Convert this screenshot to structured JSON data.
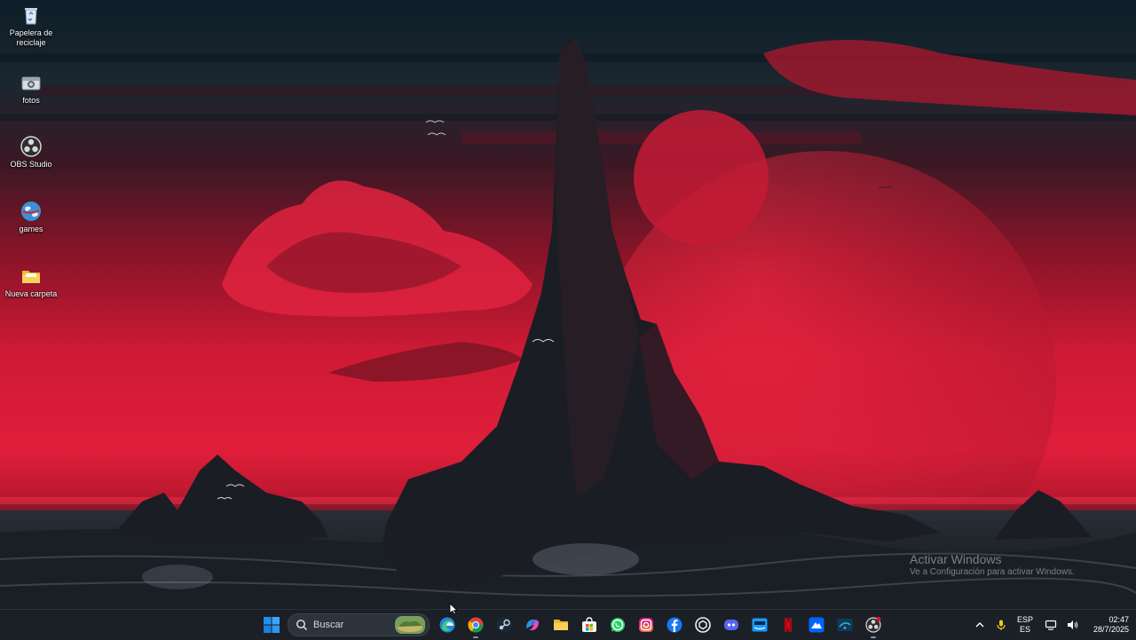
{
  "desktop": {
    "icons": [
      {
        "label": "Papelera de reciclaje",
        "icon": "recycle-bin-icon"
      },
      {
        "label": "fotos",
        "icon": "photos-icon"
      },
      {
        "label": "OBS Studio",
        "icon": "obs-studio-icon"
      },
      {
        "label": "games",
        "icon": "games-globe-icon"
      },
      {
        "label": "Nueva carpeta",
        "icon": "folder-icon"
      }
    ]
  },
  "activation": {
    "title": "Activar Windows",
    "subtitle": "Ve a Configuración para activar Windows."
  },
  "taskbar": {
    "search_placeholder": "Buscar",
    "pinned_apps": [
      "start-icon",
      "edge-icon",
      "chrome-icon",
      "steam-icon",
      "copilot-icon",
      "file-explorer-icon",
      "microsoft-store-icon",
      "whatsapp-icon",
      "instagram-icon",
      "facebook-icon",
      "chatgpt-icon",
      "discord-icon",
      "prime-video-icon",
      "netflix-icon",
      "paramount-plus-icon",
      "disney-plus-icon",
      "obs-studio-icon"
    ],
    "tray": {
      "language": "ESP",
      "layout": "ES",
      "time": "02:47",
      "date": "28/7/2025"
    }
  },
  "colors": {
    "sky_red": "#d11a36",
    "sky_dark": "#0e1e28",
    "taskbar": "#1b2026",
    "accent_blue": "#1f8ff0"
  }
}
